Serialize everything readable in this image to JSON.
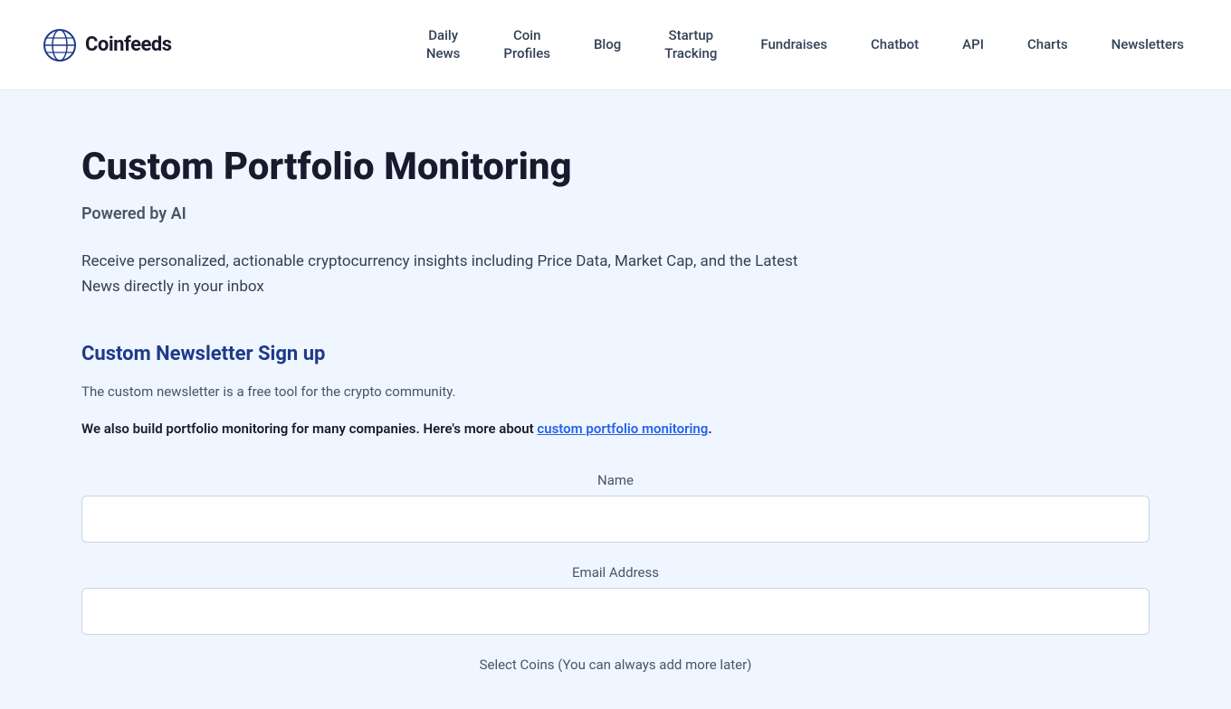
{
  "header": {
    "logo_text": "Coinfeeds",
    "nav": [
      {
        "id": "daily-news",
        "label": "Daily\nNews",
        "lines": [
          "Daily",
          "News"
        ]
      },
      {
        "id": "coin-profiles",
        "label": "Coin\nProfiles",
        "lines": [
          "Coin",
          "Profiles"
        ]
      },
      {
        "id": "blog",
        "label": "Blog",
        "lines": [
          "Blog"
        ]
      },
      {
        "id": "startup-tracking",
        "label": "Startup\nTracking",
        "lines": [
          "Startup",
          "Tracking"
        ]
      },
      {
        "id": "fundraises",
        "label": "Fundraises",
        "lines": [
          "Fundraises"
        ]
      },
      {
        "id": "chatbot",
        "label": "Chatbot",
        "lines": [
          "Chatbot"
        ]
      },
      {
        "id": "api",
        "label": "API",
        "lines": [
          "API"
        ]
      },
      {
        "id": "charts",
        "label": "Charts",
        "lines": [
          "Charts"
        ]
      },
      {
        "id": "newsletters",
        "label": "Newsletters",
        "lines": [
          "Newsletters"
        ]
      }
    ]
  },
  "page": {
    "title": "Custom Portfolio Monitoring",
    "powered_by": "Powered by AI",
    "description": "Receive personalized, actionable cryptocurrency insights including Price Data, Market Cap, and the Latest News directly in your inbox",
    "section_title": "Custom Newsletter Sign up",
    "free_tool_text": "The custom newsletter is a free tool for the crypto community.",
    "build_text_before": "We also build portfolio monitoring for many companies. Here's more about ",
    "build_link_text": "custom portfolio monitoring",
    "build_text_after": ".",
    "form": {
      "name_label": "Name",
      "name_placeholder": "",
      "email_label": "Email Address",
      "email_placeholder": "",
      "coins_label": "Select Coins (You can always add more later)"
    }
  }
}
